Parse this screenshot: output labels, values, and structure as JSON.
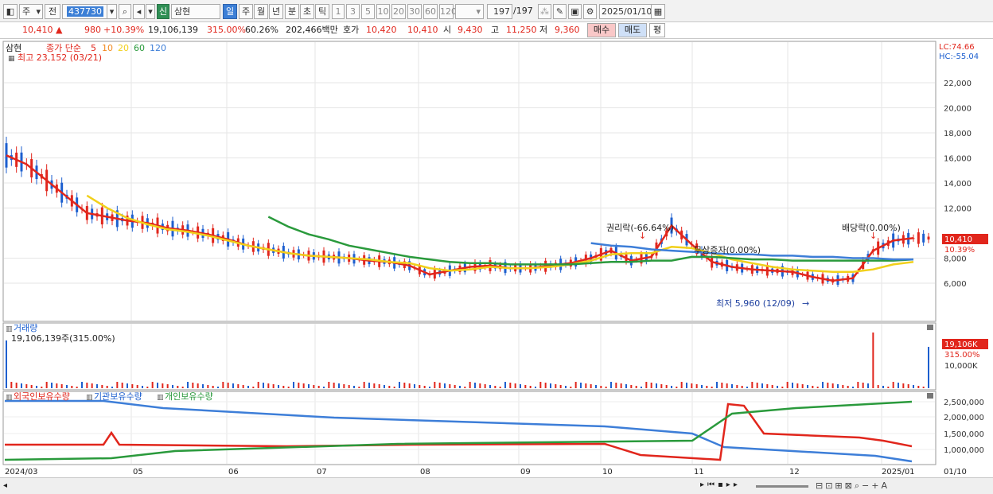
{
  "toolbar": {
    "market_label": "주",
    "period_label": "전",
    "stock_code": "437730",
    "badge": "신",
    "stock_name": "삼현",
    "period_buttons": [
      "일",
      "주",
      "월",
      "년",
      "분",
      "초",
      "틱"
    ],
    "interval_buttons": [
      "1",
      "3",
      "5",
      "10",
      "20",
      "30",
      "60",
      "120"
    ],
    "count_value": "197",
    "count_total": "/197",
    "date_value": "2025/01/10"
  },
  "infobar": {
    "price": "10,410",
    "change": "980",
    "change_pct": "+10.39%",
    "volume": "19,106,139",
    "volume_ratio": "315.00%",
    "turnover": "60.26%",
    "trade_value": "202,466백만",
    "ask_label": "호가",
    "ask1": "10,420",
    "ask2": "10,410",
    "open_label": "시",
    "open_value": "9,430",
    "high_label": "고",
    "high_value": "11,250",
    "low_label": "저",
    "low_value": "9,360",
    "buy_label": "매수",
    "sell_label": "매도",
    "eval_label": "평"
  },
  "price_pane": {
    "stock_label": "삼현",
    "ma_label": "종가 단순",
    "ma_periods": [
      "5",
      "10",
      "20",
      "60",
      "120"
    ],
    "ma_colors": [
      "#e1261c",
      "#f28a1e",
      "#f1d01b",
      "#2a9a3c",
      "#3d7ed8"
    ],
    "high_marker": "최고 23,152 (03/21)",
    "low_marker": "최저 5,960 (12/09)",
    "event_rights": "권리락(-66.64%)",
    "event_bonus": "무상증자(0.00%)",
    "event_dividend": "배당락(0.00%)",
    "lc": "LC:74.66",
    "hc": "HC:-55.04",
    "current_price_tag": "10,410",
    "current_pct_tag": "10.39%",
    "y_ticks": [
      "22,000",
      "20,000",
      "18,000",
      "16,000",
      "14,000",
      "12,000",
      "8,000",
      "6,000"
    ]
  },
  "volume_pane": {
    "title": "거래량",
    "value_label": "19,106,139주(315.00%)",
    "tag_value": "19,106K",
    "tag_pct": "315.00%",
    "y_tick": "10,000K"
  },
  "holding_pane": {
    "legend": [
      "외국인보유수량",
      "기관보유수량",
      "개인보유수량"
    ],
    "y_ticks": [
      "2,500,000",
      "2,000,000",
      "1,500,000",
      "1,000,000"
    ]
  },
  "x_axis": {
    "labels": [
      "2024/03",
      "05",
      "06",
      "07",
      "08",
      "09",
      "10",
      "11",
      "12",
      "2025/01",
      "01/10"
    ]
  },
  "chart_data": {
    "type": "line",
    "title": "",
    "xlabel": "",
    "ylabel": "",
    "ylim": [
      5000,
      23500
    ],
    "series": [
      {
        "name": "종가 단순 5",
        "color": "#e1261c",
        "values": [
          16200,
          15500,
          14200,
          12900,
          11600,
          11300,
          11000,
          10800,
          10400,
          10200,
          9900,
          9500,
          9000,
          8700,
          8400,
          8200,
          8100,
          8000,
          7800,
          7700,
          7400,
          6700,
          7000,
          7300,
          7400,
          7200,
          7200,
          7400,
          7600,
          8000,
          8600,
          7800,
          8100,
          10600,
          9100,
          7700,
          7300,
          7100,
          7000,
          6900,
          6500,
          6200,
          6400,
          8600,
          9400,
          9600
        ]
      },
      {
        "name": "종가 단순 20",
        "color": "#f1d01b",
        "values": [
          null,
          null,
          null,
          null,
          13000,
          12000,
          11200,
          10700,
          10300,
          10100,
          9800,
          9400,
          9000,
          8700,
          8400,
          8200,
          8100,
          8000,
          7900,
          7700,
          7600,
          7200,
          7000,
          7100,
          7300,
          7200,
          7200,
          7300,
          7500,
          7800,
          8300,
          8400,
          8400,
          8900,
          8800,
          8400,
          7900,
          7600,
          7300,
          7100,
          7000,
          6900,
          6900,
          7100,
          7500,
          7700
        ]
      },
      {
        "name": "종가 단순 60",
        "color": "#2a9a3c",
        "values": [
          null,
          null,
          null,
          null,
          null,
          null,
          null,
          null,
          null,
          null,
          null,
          null,
          null,
          11300,
          10500,
          9900,
          9500,
          9000,
          8700,
          8400,
          8100,
          7900,
          7700,
          7600,
          7600,
          7500,
          7500,
          7500,
          7500,
          7600,
          7700,
          7700,
          7800,
          7800,
          8100,
          8100,
          8000,
          7900,
          7900,
          7800,
          7800,
          7800,
          7800,
          7800,
          7800,
          7900
        ]
      },
      {
        "name": "종가 단순 120",
        "color": "#3d7ed8",
        "values": [
          null,
          null,
          null,
          null,
          null,
          null,
          null,
          null,
          null,
          null,
          null,
          null,
          null,
          null,
          null,
          null,
          null,
          null,
          null,
          null,
          null,
          null,
          null,
          null,
          null,
          null,
          null,
          null,
          null,
          9200,
          9000,
          8900,
          8700,
          8600,
          8500,
          8400,
          8300,
          8300,
          8200,
          8200,
          8100,
          8100,
          8000,
          8000,
          7900,
          7900
        ]
      }
    ]
  }
}
